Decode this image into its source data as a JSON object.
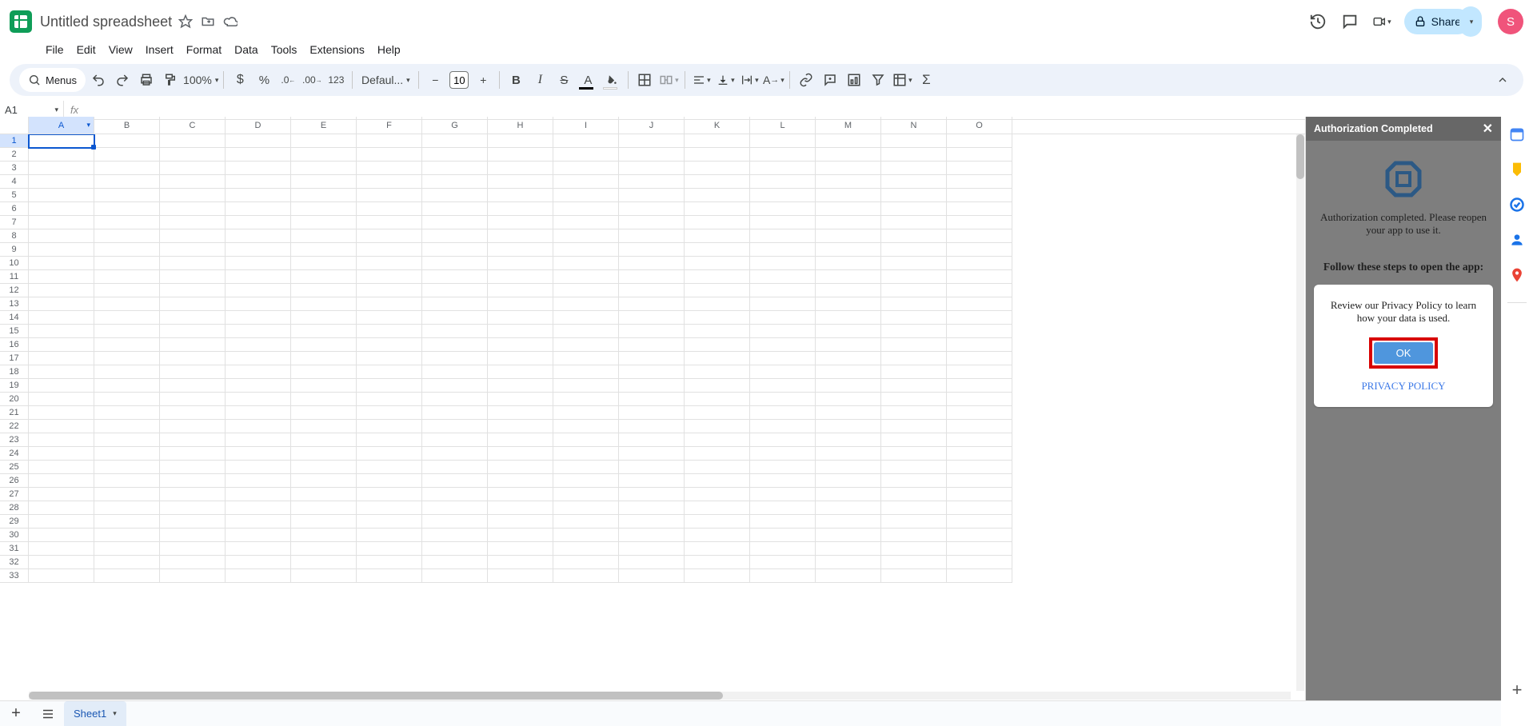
{
  "header": {
    "doc_title": "Untitled spreadsheet",
    "share_label": "Share",
    "avatar_letter": "S"
  },
  "menubar": [
    "File",
    "Edit",
    "View",
    "Insert",
    "Format",
    "Data",
    "Tools",
    "Extensions",
    "Help"
  ],
  "toolbar": {
    "search_label": "Menus",
    "zoom": "100%",
    "font_name": "Defaul...",
    "font_size": "10",
    "format_123": "123"
  },
  "formula_row": {
    "name_box": "A1",
    "fx_label": "fx"
  },
  "columns": [
    "A",
    "B",
    "C",
    "D",
    "E",
    "F",
    "G",
    "H",
    "I",
    "J",
    "K",
    "L",
    "M",
    "N",
    "O"
  ],
  "row_count": 33,
  "selected": {
    "col": "A",
    "row": 1
  },
  "sidepanel": {
    "title": "Authorization Completed",
    "auth_msg": "Authorization completed. Please reopen your app to use it.",
    "steps_heading": "Follow these steps to open the app:",
    "card_text": "Review our Privacy Policy to learn how your data is used.",
    "ok_label": "OK",
    "privacy_link": "PRIVACY POLICY"
  },
  "tabs": {
    "sheet_label": "Sheet1"
  }
}
